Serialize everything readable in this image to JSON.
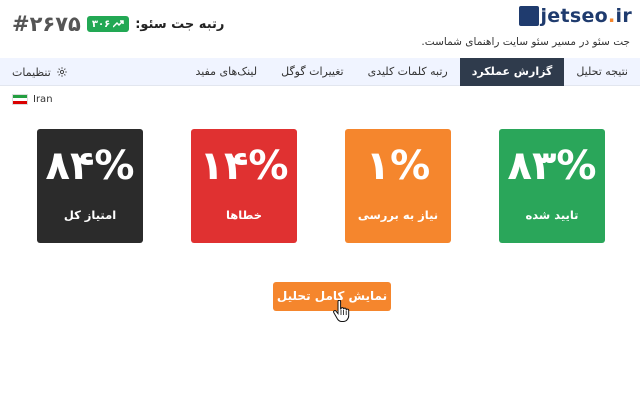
{
  "header": {
    "logo": {
      "main": "jetseo",
      "dot": ".",
      "tld": "ir"
    },
    "tagline": "جت سئو در مسیر سئو سایت راهنمای شماست.",
    "rank_label": "رتبه جت سئو:",
    "rank_value": "#۲۶۷۵",
    "rank_change": "۳۰۶"
  },
  "tabs": [
    {
      "label": "نتیجه تحلیل",
      "active": false
    },
    {
      "label": "گزارش عملکرد",
      "active": true
    },
    {
      "label": "رتبه کلمات کلیدی",
      "active": false
    },
    {
      "label": "تغییرات گوگل",
      "active": false
    },
    {
      "label": "لینک‌های مفید",
      "active": false
    }
  ],
  "settings_label": "تنظیمات",
  "country": {
    "name": "Iran",
    "flag_colors": [
      "#239f40",
      "#ffffff",
      "#da0000"
    ]
  },
  "cards": [
    {
      "percent": "۸۴%",
      "label": "امتیاز کل",
      "color": "#2b2b2b"
    },
    {
      "percent": "۱۴%",
      "label": "خطاها",
      "color": "#e03131"
    },
    {
      "percent": "۱%",
      "label": "نیاز به بررسی",
      "color": "#f5862d"
    },
    {
      "percent": "۸۳%",
      "label": "تایید شده",
      "color": "#2aa65a"
    }
  ],
  "cta_label": "نمایش کامل تحلیل",
  "colors": {
    "brand": "#1f3b6e",
    "accent": "#f5862d",
    "tab_active": "#2f3b4c",
    "tabbar_bg": "#f0f4ff",
    "rank_badge": "#22a854"
  }
}
